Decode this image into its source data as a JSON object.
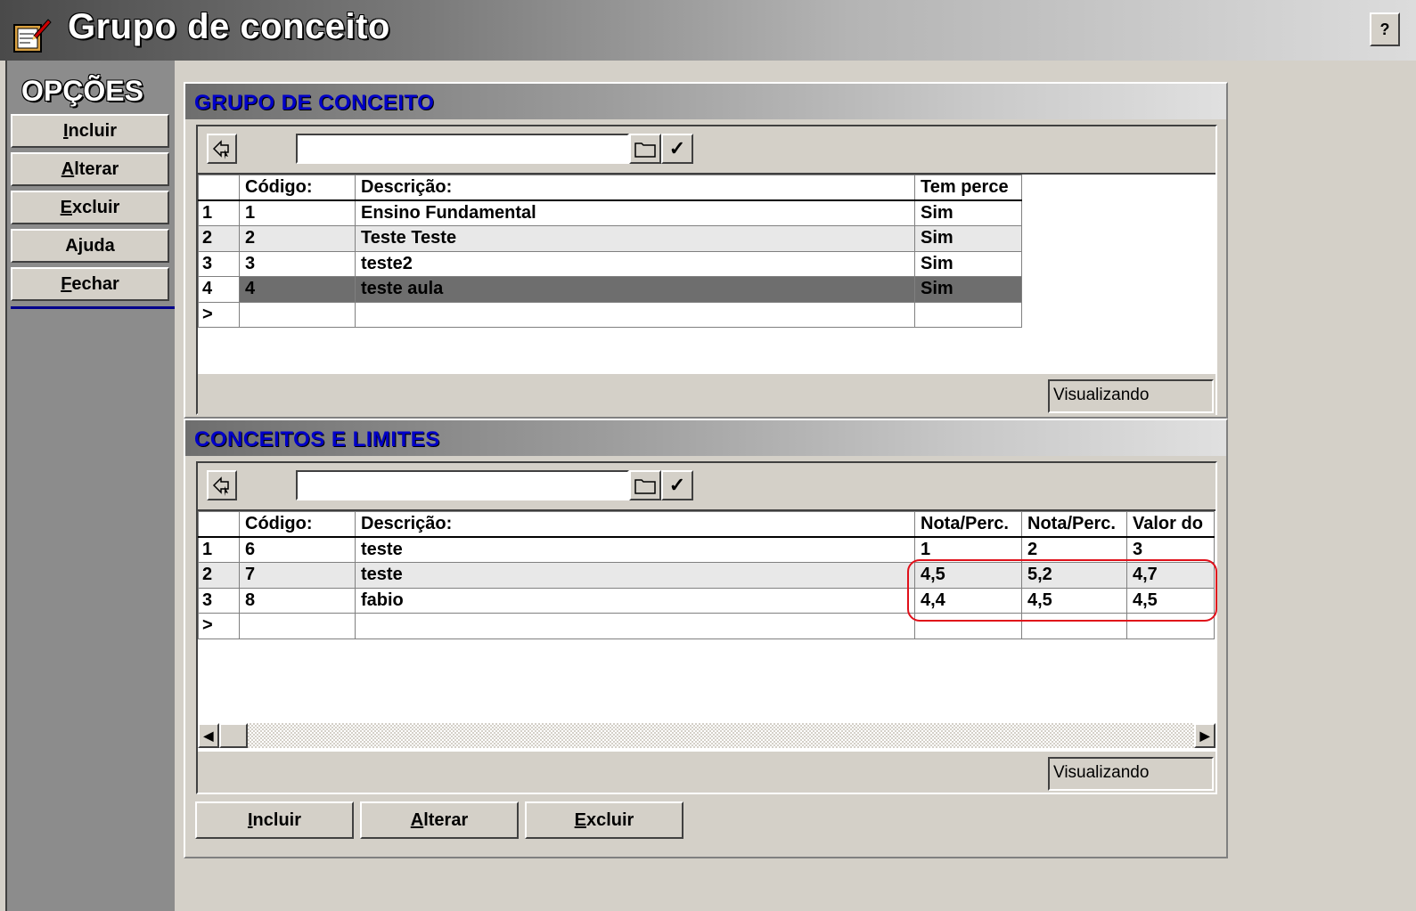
{
  "window": {
    "title": "Grupo de conceito",
    "help_label": "?"
  },
  "sidebar": {
    "title": "OPÇÕES",
    "items": [
      {
        "first": "I",
        "rest": "ncluir"
      },
      {
        "first": "A",
        "rest": "lterar"
      },
      {
        "first": "E",
        "rest": "xcluir"
      },
      {
        "first": "",
        "rest": "Ajuda"
      },
      {
        "first": "F",
        "rest": "echar"
      }
    ]
  },
  "grupo": {
    "section_title": "GRUPO DE CONCEITO",
    "columns": [
      "Código:",
      "Descrição:",
      "Tem perce"
    ],
    "rows": [
      {
        "n": "1",
        "codigo": "1",
        "descricao": "Ensino Fundamental",
        "tem": "Sim"
      },
      {
        "n": "2",
        "codigo": "2",
        "descricao": "Teste Teste",
        "tem": "Sim"
      },
      {
        "n": "3",
        "codigo": "3",
        "descricao": "teste2",
        "tem": "Sim"
      },
      {
        "n": "4",
        "codigo": "4",
        "descricao": "teste aula",
        "tem": "Sim"
      }
    ],
    "new_row_marker": ">",
    "status": "Visualizando"
  },
  "conceitos": {
    "section_title": "CONCEITOS E LIMITES",
    "columns": [
      "Código:",
      "Descrição:",
      "Nota/Perc.",
      "Nota/Perc.",
      "Valor do"
    ],
    "rows": [
      {
        "n": "1",
        "codigo": "6",
        "descricao": "teste",
        "c1": "1",
        "c2": "2",
        "c3": "3"
      },
      {
        "n": "2",
        "codigo": "7",
        "descricao": "teste",
        "c1": "4,5",
        "c2": "5,2",
        "c3": "4,7"
      },
      {
        "n": "3",
        "codigo": "8",
        "descricao": "fabio",
        "c1": "4,4",
        "c2": "4,5",
        "c3": "4,5"
      }
    ],
    "new_row_marker": ">",
    "status": "Visualizando"
  },
  "bottom_buttons": [
    {
      "first": "I",
      "rest": "ncluir"
    },
    {
      "first": "A",
      "rest": "lterar"
    },
    {
      "first": "E",
      "rest": "xcluir"
    }
  ],
  "colors": {
    "selected_row": "#6e6e6e",
    "highlight_ring": "#e0101a",
    "section_title": "#0000c8"
  }
}
